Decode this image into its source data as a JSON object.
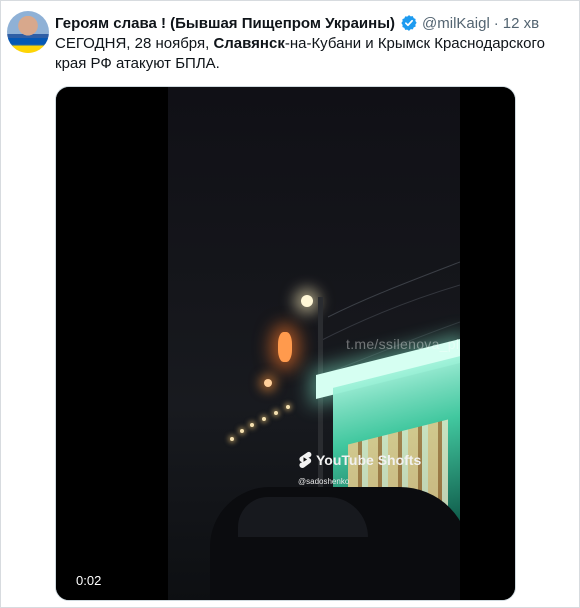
{
  "tweet": {
    "author_name": "Героям слава ! (Бывшая Пищепром Украины)",
    "verified_icon": "verified-badge-icon",
    "handle": "@milKaigl",
    "separator": "·",
    "time": "12 хв",
    "text_before": "СЕГОДНЯ, 28 ноября, ",
    "text_bold": "Славянск",
    "text_after": "-на-Кубани и Крымск Краснодарского края РФ атакуют БПЛА."
  },
  "media": {
    "watermark": "t.me/ssilenova_plus",
    "shorts_label": "YouTube Shofts",
    "shorts_handle": "@sadoshenko",
    "timestamp": "0:02"
  },
  "colors": {
    "secondary_text": "#536471",
    "verified_blue": "#1d9bf0",
    "kiosk_glow": "#44d1a6"
  }
}
